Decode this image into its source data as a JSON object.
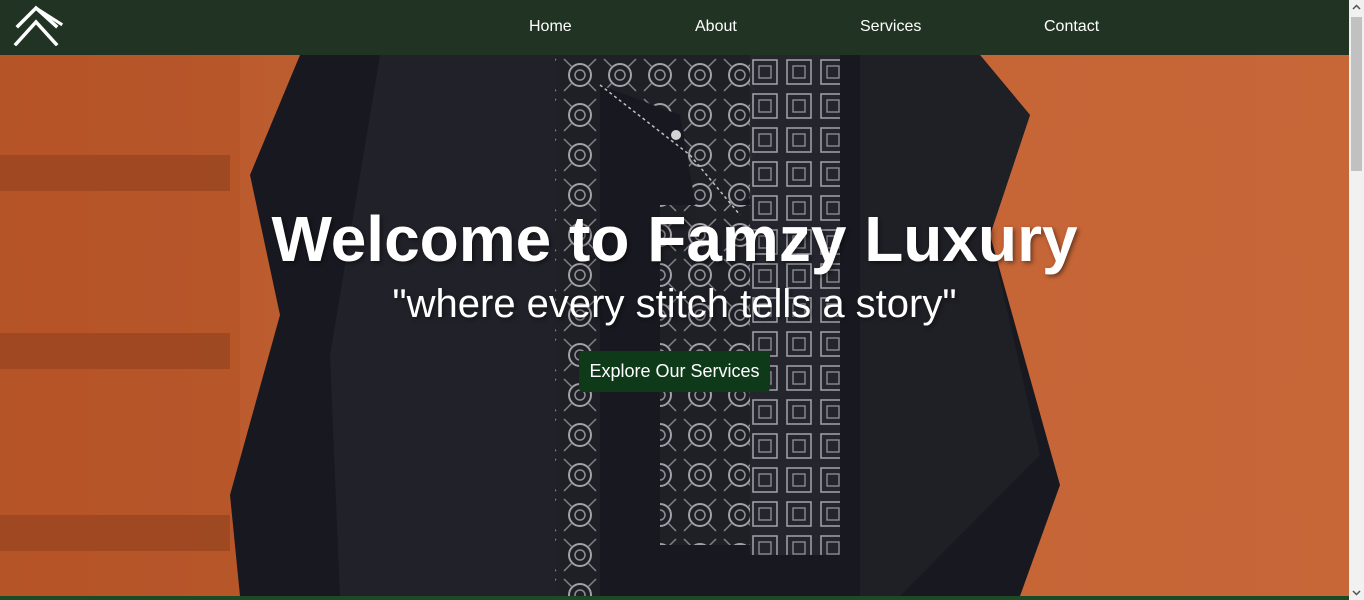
{
  "nav": {
    "logo_icon": "double-chevron-up-icon",
    "items": [
      {
        "label": "Home"
      },
      {
        "label": "About"
      },
      {
        "label": "Services"
      },
      {
        "label": "Contact"
      }
    ]
  },
  "hero": {
    "title": "Welcome to Famzy Luxury",
    "subtitle": "\"where every stitch tells a story\"",
    "cta_label": "Explore Our Services",
    "background": "agbada-garment-photo"
  },
  "colors": {
    "nav_bg": "#213322",
    "cta_bg": "#0e3a1a",
    "hero_bg": "#d46a38",
    "text": "#ffffff"
  }
}
